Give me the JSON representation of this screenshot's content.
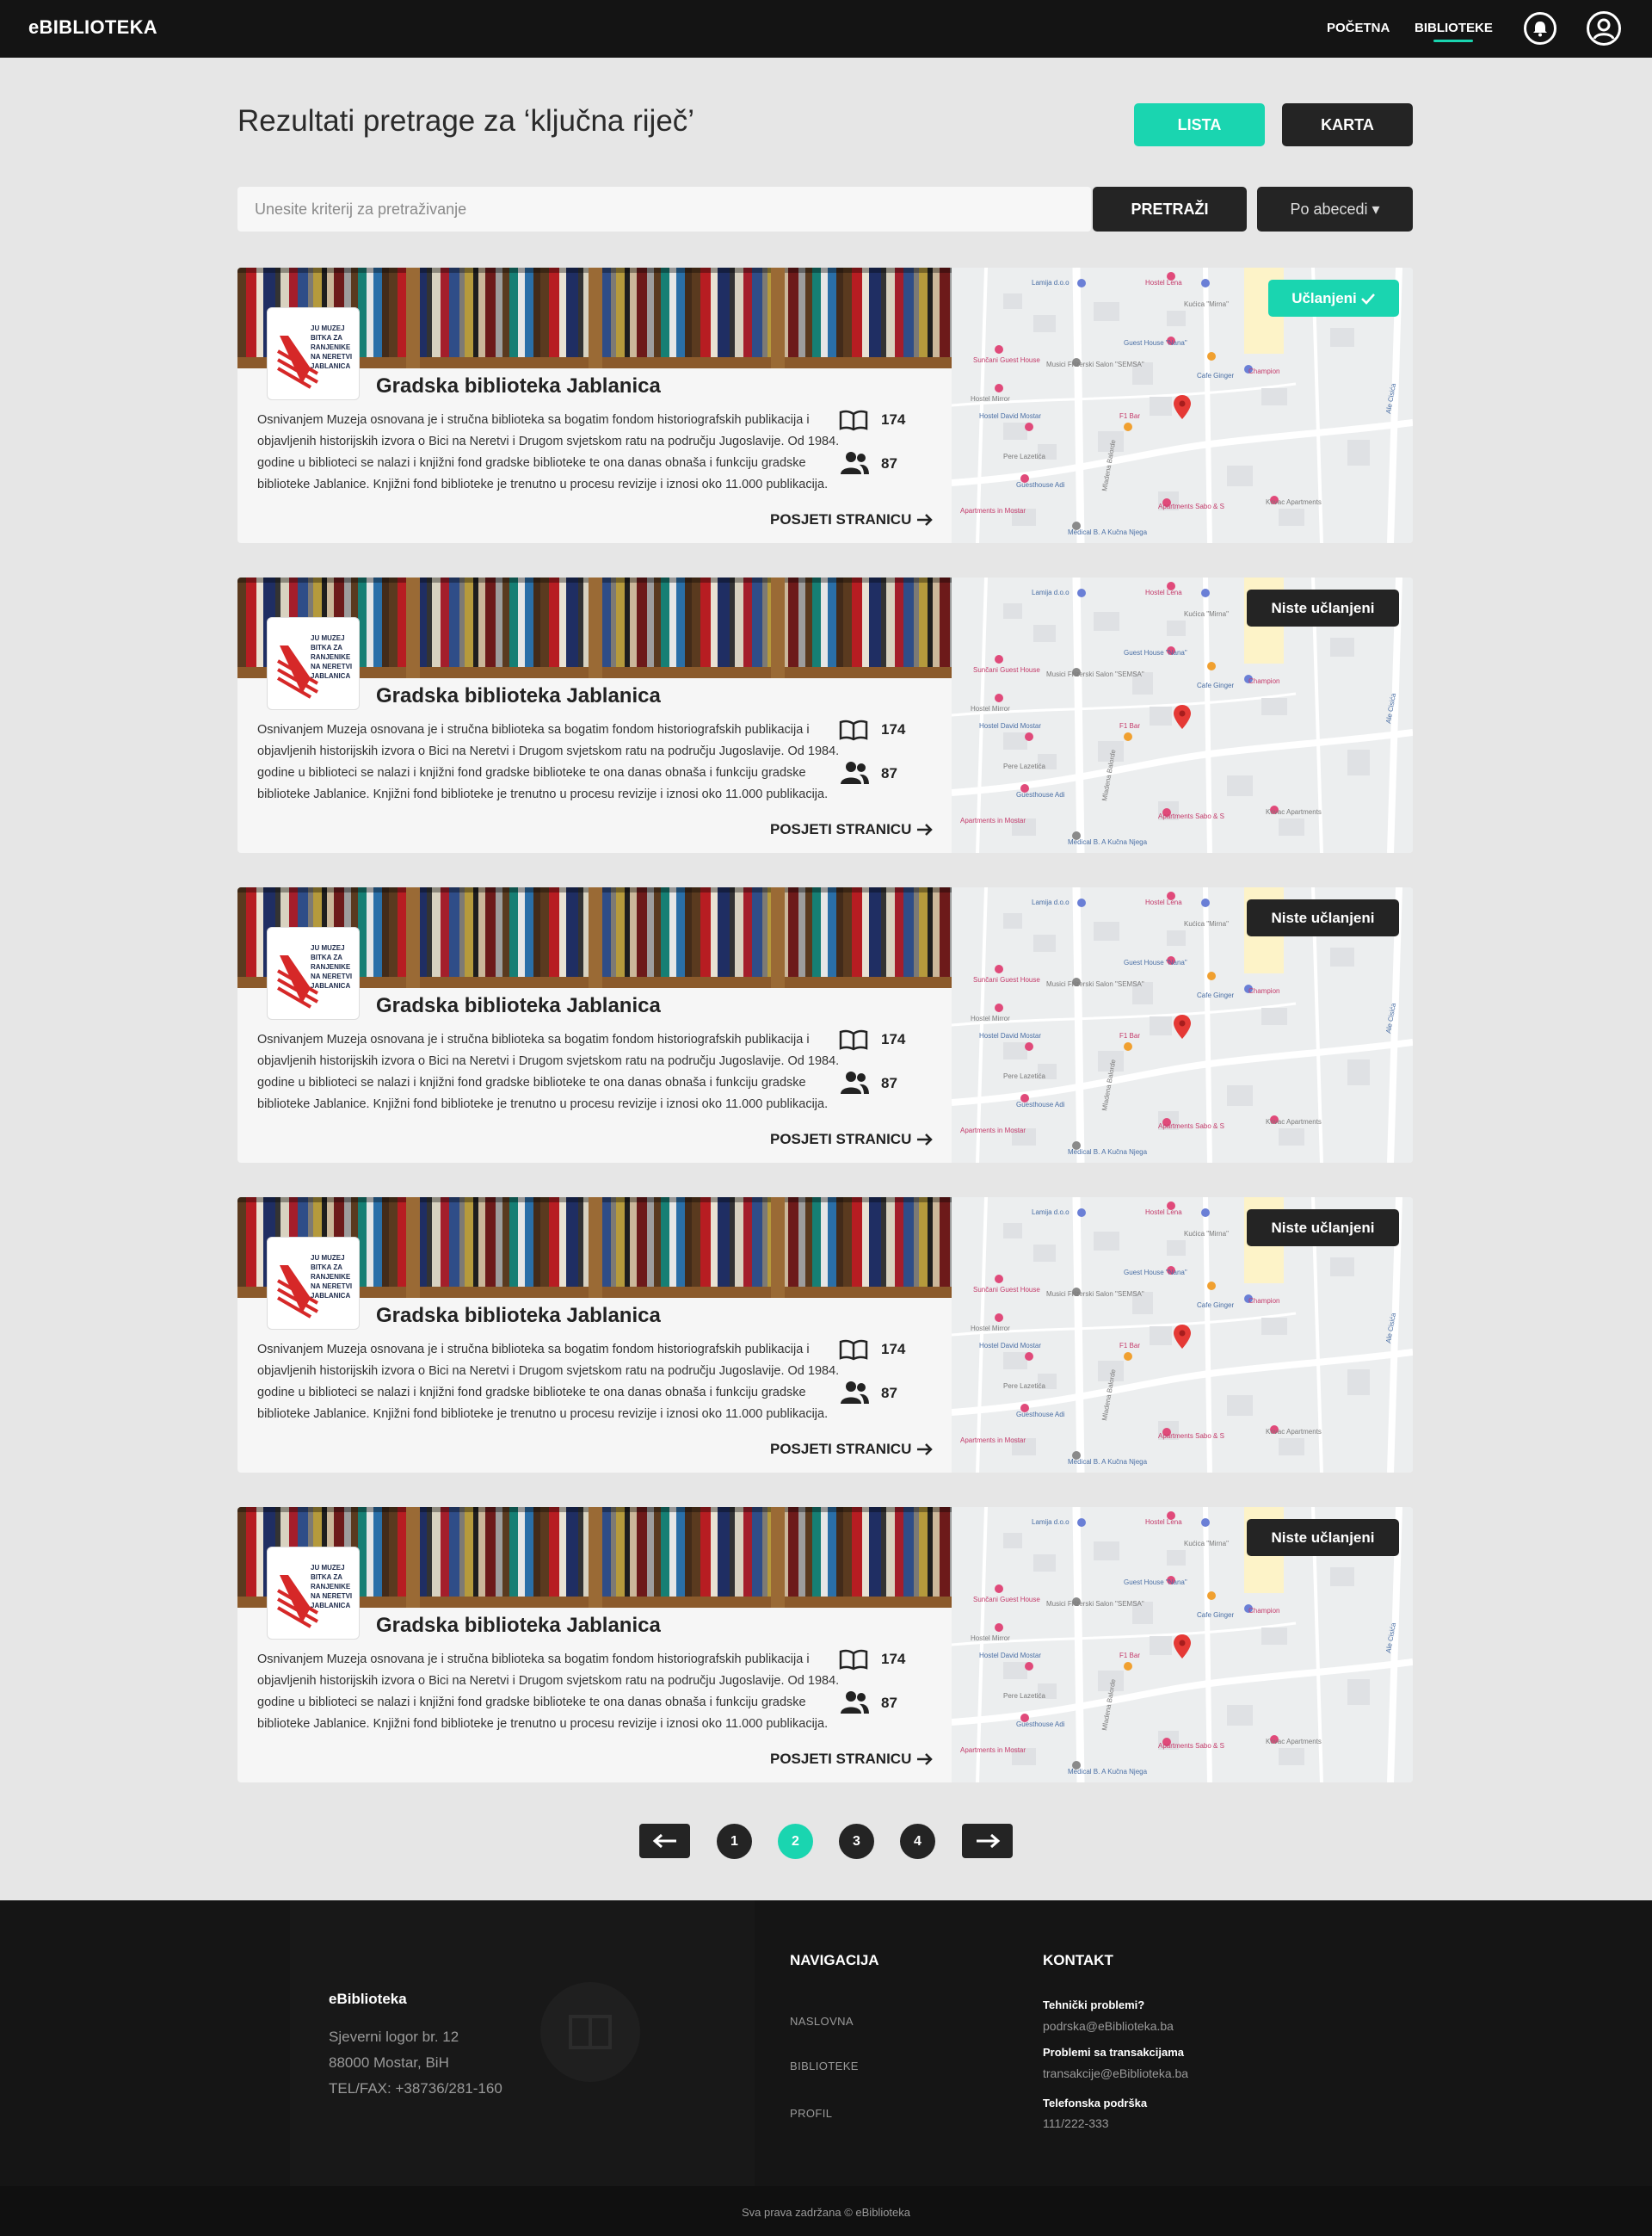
{
  "nav": {
    "brand": "eBIBLIOTEKA",
    "links": [
      "POČETNA",
      "BIBLIOTEKE"
    ],
    "active_link": "BIBLIOTEKE",
    "accent": "#1ad5b0"
  },
  "header": {
    "title": "Rezultati pretrage za ‘ključna riječ’",
    "view_buttons": [
      "LISTA",
      "KARTA"
    ],
    "active_view": "LISTA"
  },
  "search": {
    "placeholder": "Unesite kriterij za pretraživanje",
    "value": "",
    "button": "PRETRAŽI",
    "sort": "Po abecedi ▾"
  },
  "libraries": [
    {
      "name": "Gradska biblioteka Jablanica",
      "description": "Osnivanjem Muzeja osnovana je i stručna biblioteka sa bogatim fondom historiografskih publikacija i objavljenih historijskih izvora o Bici na Neretvi i Drugom svjetskom ratu na području Jugoslavije. Od 1984. godine u biblioteci se nalazi i knjižni fond gradske biblioteke te ona danas obnaša i funkciju gradske biblioteke Jablanice. Knjižni fond biblioteke je trenutno u procesu revizije i iznosi oko 11.000 publikacija.",
      "books": "174",
      "members": "87",
      "visit": "POSJETI STRANICU",
      "membership": "Učlanjeni",
      "is_member": true
    },
    {
      "name": "Gradska biblioteka Jablanica",
      "description": "Osnivanjem Muzeja osnovana je i stručna biblioteka sa bogatim fondom historiografskih publikacija i objavljenih historijskih izvora o Bici na Neretvi i Drugom svjetskom ratu na području Jugoslavije. Od 1984. godine u biblioteci se nalazi i knjižni fond gradske biblioteke te ona danas obnaša i funkciju gradske biblioteke Jablanice. Knjižni fond biblioteke je trenutno u procesu revizije i iznosi oko 11.000 publikacija.",
      "books": "174",
      "members": "87",
      "visit": "POSJETI STRANICU",
      "membership": "Niste učlanjeni",
      "is_member": false
    },
    {
      "name": "Gradska biblioteka Jablanica",
      "description": "Osnivanjem Muzeja osnovana je i stručna biblioteka sa bogatim fondom historiografskih publikacija i objavljenih historijskih izvora o Bici na Neretvi i Drugom svjetskom ratu na području Jugoslavije. Od 1984. godine u biblioteci se nalazi i knjižni fond gradske biblioteke te ona danas obnaša i funkciju gradske biblioteke Jablanice. Knjižni fond biblioteke je trenutno u procesu revizije i iznosi oko 11.000 publikacija.",
      "books": "174",
      "members": "87",
      "visit": "POSJETI STRANICU",
      "membership": "Niste učlanjeni",
      "is_member": false
    },
    {
      "name": "Gradska biblioteka Jablanica",
      "description": "Osnivanjem Muzeja osnovana je i stručna biblioteka sa bogatim fondom historiografskih publikacija i objavljenih historijskih izvora o Bici na Neretvi i Drugom svjetskom ratu na području Jugoslavije. Od 1984. godine u biblioteci se nalazi i knjižni fond gradske biblioteke te ona danas obnaša i funkciju gradske biblioteke Jablanice. Knjižni fond biblioteke je trenutno u procesu revizije i iznosi oko 11.000 publikacija.",
      "books": "174",
      "members": "87",
      "visit": "POSJETI STRANICU",
      "membership": "Niste učlanjeni",
      "is_member": false
    },
    {
      "name": "Gradska biblioteka Jablanica",
      "description": "Osnivanjem Muzeja osnovana je i stručna biblioteka sa bogatim fondom historiografskih publikacija i objavljenih historijskih izvora o Bici na Neretvi i Drugom svjetskom ratu na području Jugoslavije. Od 1984. godine u biblioteci se nalazi i knjižni fond gradske biblioteke te ona danas obnaša i funkciju gradske biblioteke Jablanice. Knjižni fond biblioteke je trenutno u procesu revizije i iznosi oko 11.000 publikacija.",
      "books": "174",
      "members": "87",
      "visit": "POSJETI STRANICU",
      "membership": "Niste učlanjeni",
      "is_member": false
    }
  ],
  "logo_text": [
    "JU MUZEJ",
    "BITKA ZA",
    "RANJENIKE",
    "NA NERETVI",
    "JABLANICA"
  ],
  "map_labels": [
    "Lamija d.o.o",
    "Hostel Lena",
    "Kućica \"Mirna\"",
    "Guest House \"Nana\"",
    "Sunčani Guest House",
    "Musici Frizerski Salon \"SEMSA\"",
    "Cafe Ginger",
    "Champion",
    "Hostel Mirror",
    "Hostel David Mostar",
    "F1 Bar",
    "Pere Lazetića",
    "Guesthouse Adi",
    "Apartments Sabo & S",
    "Kovac Apartments",
    "Medical B. A Kučna Njega",
    "Apartments in Mostar",
    "Mladena Balorde",
    "Ale Cisića"
  ],
  "pagination": {
    "prev": "←",
    "pages": [
      "1",
      "2",
      "3",
      "4"
    ],
    "current": "2",
    "next": "→"
  },
  "footer": {
    "brand": "eBiblioteka",
    "address": [
      "Sjeverni logor br. 12",
      "88000 Mostar, BiH",
      "TEL/FAX: +38736/281-160"
    ],
    "nav_title": "NAVIGACIJA",
    "nav_links": [
      "NASLOVNA",
      "BIBLIOTEKE",
      "PROFIL"
    ],
    "contact_title": "KONTAKT",
    "contacts": [
      {
        "label": "Tehnički problemi?",
        "value": "podrska@eBiblioteka.ba"
      },
      {
        "label": "Problemi sa transakcijama",
        "value": "transakcije@eBiblioteka.ba"
      },
      {
        "label": "Telefonska podrška",
        "value": "111/222-333"
      }
    ],
    "copyright": "Sva prava zadržana © eBiblioteka"
  }
}
